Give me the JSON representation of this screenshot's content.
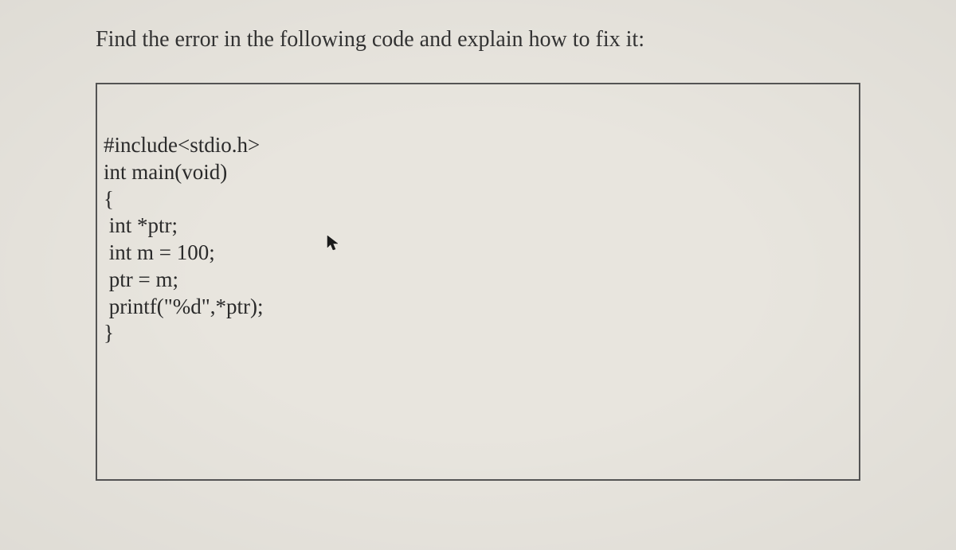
{
  "question": "Find the error in the following code and explain how to fix it:",
  "code": {
    "line1": "#include<stdio.h>",
    "line2": "int main(void)",
    "line3": "{",
    "line4": " int *ptr;",
    "line5": " int m = 100;",
    "line6": " ptr = m;",
    "line7": " printf(\"%d\",*ptr);",
    "line8": "}"
  }
}
